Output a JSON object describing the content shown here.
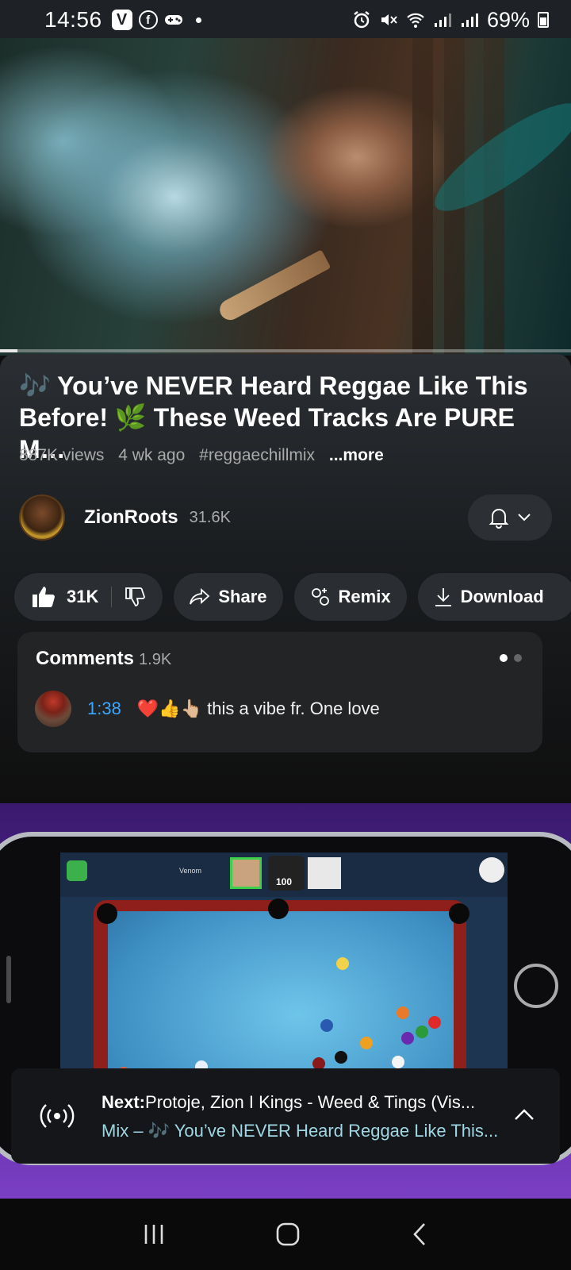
{
  "status_bar": {
    "time": "14:56",
    "app_badge_v": "V",
    "app_badge_f": "f",
    "battery": "69%"
  },
  "video": {
    "progress_fraction": 0.03
  },
  "details": {
    "title": "🎶 You’ve NEVER Heard Reggae Like This Before! 🌿 These Weed Tracks Are PURE M…",
    "views": "887K views",
    "age": "4 wk ago",
    "hashtag": "#reggaechillmix",
    "more": "...more"
  },
  "channel": {
    "name": "ZionRoots",
    "subscribers": "31.6K"
  },
  "actions": {
    "likes": "31K",
    "share": "Share",
    "remix": "Remix",
    "download": "Download"
  },
  "comments": {
    "label": "Comments",
    "count": "1.9K",
    "top_comment": {
      "timestamp": "1:38",
      "text": "❤️👍👆🏼 this a vibe fr. One love"
    }
  },
  "next_up": {
    "prefix": "Next:",
    "title": "Protoje, Zion I Kings - Weed & Tings (Vis...",
    "mix": "Mix – 🎶 You’ve NEVER Heard Reggae Like This..."
  },
  "game_thumbnail": {
    "hud_score": "100",
    "player1": "Venom"
  },
  "colors": {
    "link_blue": "#3ea6ff",
    "accent_cyan": "#9fd7e4",
    "surface": "#0f0f0f"
  }
}
